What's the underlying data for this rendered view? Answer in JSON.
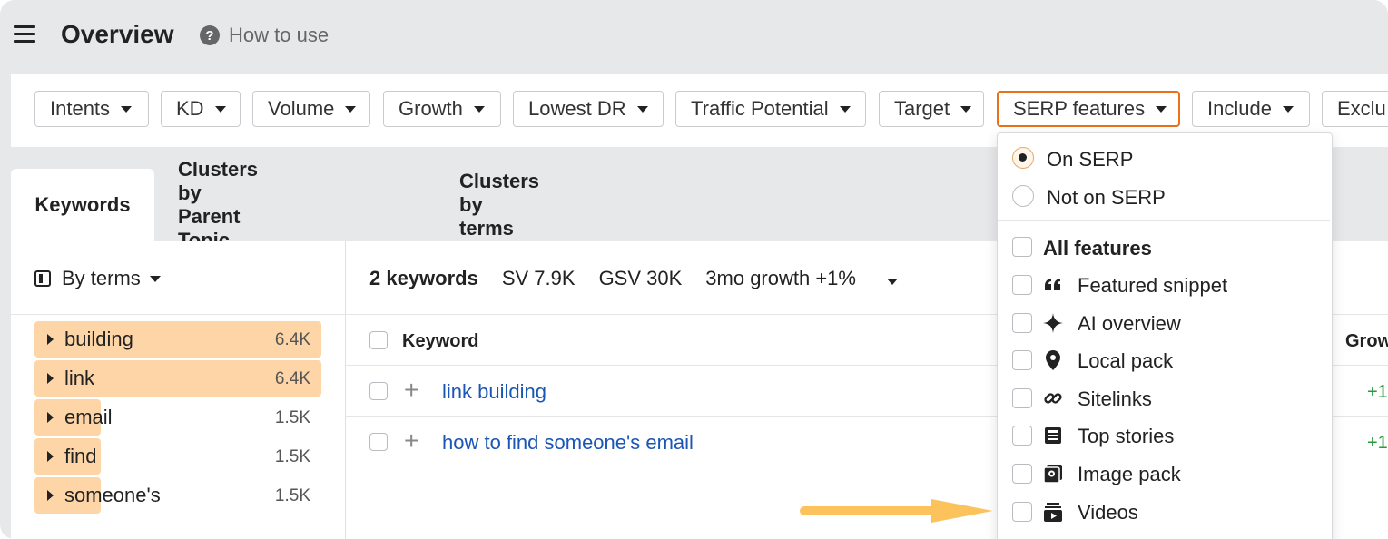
{
  "header": {
    "title": "Overview",
    "how_to_use": "How to use"
  },
  "filters": [
    {
      "label": "Intents"
    },
    {
      "label": "KD"
    },
    {
      "label": "Volume"
    },
    {
      "label": "Growth"
    },
    {
      "label": "Lowest DR"
    },
    {
      "label": "Traffic Potential"
    },
    {
      "label": "Target"
    },
    {
      "label": "SERP features",
      "active": true
    },
    {
      "label": "Include"
    },
    {
      "label": "Exclu"
    }
  ],
  "tabs": [
    {
      "label": "Keywords",
      "selected": true
    },
    {
      "label": "Clusters by Parent Topic"
    },
    {
      "label": "Clusters by terms"
    }
  ],
  "left_panel": {
    "group_label": "By terms",
    "terms": [
      {
        "label": "building",
        "value": "6.4K",
        "fill": 1.0
      },
      {
        "label": "link",
        "value": "6.4K",
        "fill": 1.0
      },
      {
        "label": "email",
        "value": "1.5K",
        "fill": 0.23
      },
      {
        "label": "find",
        "value": "1.5K",
        "fill": 0.23
      },
      {
        "label": "someone's",
        "value": "1.5K",
        "fill": 0.23
      }
    ]
  },
  "summary": {
    "keywords": "2 keywords",
    "sv": "SV 7.9K",
    "gsv": "GSV 30K",
    "growth": "3mo growth +1%"
  },
  "table": {
    "col_keyword": "Keyword",
    "col_growth": "Grow",
    "rows": [
      {
        "keyword": "link building",
        "growth": "+1"
      },
      {
        "keyword": "how to find someone's email",
        "growth": "+1"
      }
    ]
  },
  "dropdown": {
    "radios": [
      {
        "label": "On SERP",
        "selected": true
      },
      {
        "label": "Not on SERP",
        "selected": false
      }
    ],
    "all_features": "All features",
    "features": [
      {
        "label": "Featured snippet",
        "icon": "quote-icon"
      },
      {
        "label": "AI overview",
        "icon": "sparkle-icon"
      },
      {
        "label": "Local pack",
        "icon": "map-pin-icon"
      },
      {
        "label": "Sitelinks",
        "icon": "link-icon"
      },
      {
        "label": "Top stories",
        "icon": "news-icon"
      },
      {
        "label": "Image pack",
        "icon": "image-icon"
      },
      {
        "label": "Videos",
        "icon": "video-icon"
      }
    ]
  },
  "colors": {
    "accent": "#e8711a",
    "term_bar": "#fdd5a6",
    "link": "#1a56b3",
    "growth": "#2a9b3a",
    "arrow": "#fcc35c"
  }
}
